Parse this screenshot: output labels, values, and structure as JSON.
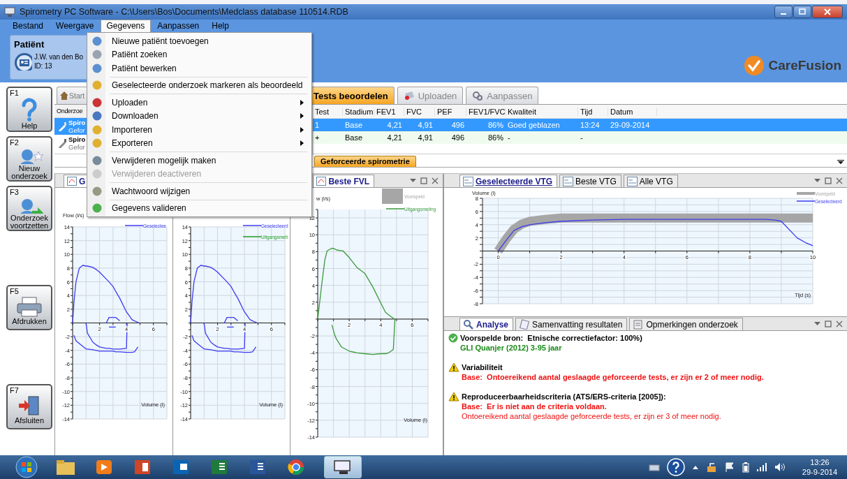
{
  "window": {
    "title": "Spirometry PC Software - C:\\Users\\Bos\\Documents\\Medclass database 110514.RDB"
  },
  "menu_bar": [
    {
      "label": "Bestand",
      "selected": false
    },
    {
      "label": "Weergave",
      "selected": false
    },
    {
      "label": "Gegevens",
      "selected": true
    },
    {
      "label": "Aanpassen",
      "selected": false
    },
    {
      "label": "Help",
      "selected": false
    }
  ],
  "dropdown_menu": {
    "groups": [
      [
        {
          "label": "Nieuwe patiënt toevoegen",
          "submenu": false,
          "disabled": false
        },
        {
          "label": "Patiënt zoeken",
          "submenu": false,
          "disabled": false
        },
        {
          "label": "Patiënt bewerken",
          "submenu": false,
          "disabled": false
        }
      ],
      [
        {
          "label": "Geselecteerde onderzoek markeren als beoordeeld",
          "submenu": false,
          "disabled": false
        }
      ],
      [
        {
          "label": "Uploaden",
          "submenu": true,
          "disabled": false
        },
        {
          "label": "Downloaden",
          "submenu": true,
          "disabled": false
        },
        {
          "label": "Importeren",
          "submenu": true,
          "disabled": false
        },
        {
          "label": "Exporteren",
          "submenu": true,
          "disabled": false
        }
      ],
      [
        {
          "label": "Verwijderen mogelijk maken",
          "submenu": false,
          "disabled": false
        },
        {
          "label": "Verwijderen deactiveren",
          "submenu": false,
          "disabled": true
        }
      ],
      [
        {
          "label": "Wachtwoord wijzigen",
          "submenu": false,
          "disabled": false
        }
      ],
      [
        {
          "label": "Gegevens valideren",
          "submenu": false,
          "disabled": false
        }
      ]
    ]
  },
  "patient": {
    "title": "Patiënt",
    "name": "J.W. van den Bo",
    "id": "ID: 13"
  },
  "logo": {
    "text": "CareFusion"
  },
  "function_keys": [
    {
      "key": "F1",
      "label": "Help"
    },
    {
      "key": "F2",
      "label": "Nieuw onderzoek"
    },
    {
      "key": "F3",
      "label": "Onderzoek voortzetten"
    },
    {
      "key": "F5",
      "label": "Afdrukken"
    },
    {
      "key": "F7",
      "label": "Afsluiten"
    }
  ],
  "main_tabs": [
    {
      "label": "Start",
      "selected": false
    },
    {
      "label": "Tests beoordelen",
      "selected": true
    },
    {
      "label": "Uploaden",
      "selected": false
    },
    {
      "label": "Aanpassen",
      "selected": false
    }
  ],
  "exam_list": {
    "header": "Onderzoe",
    "items": [
      {
        "title": "Spiro",
        "subtitle": "Gefor",
        "selected": true
      },
      {
        "title": "Spiro",
        "subtitle": "Gefor",
        "selected": false
      }
    ]
  },
  "tests_table": {
    "columns": [
      "Test",
      "Stadium",
      "FEV1",
      "FVC",
      "PEF",
      "FEV1/FVC",
      "Kwaliteit",
      "Tijd",
      "Datum"
    ],
    "rows": [
      {
        "cells": [
          "1",
          "Base",
          "4,21",
          "4,91",
          "496",
          "86%",
          "Goed geblazen",
          "13:24",
          "29-09-2014"
        ],
        "selected": true
      },
      {
        "cells": [
          "+",
          "Base",
          "4,21",
          "4,91",
          "496",
          "86%",
          "-",
          "-"
        ],
        "selected": false
      }
    ]
  },
  "test_type_tabs": [
    {
      "label": "Geforceerde spirometrie",
      "selected": true
    }
  ],
  "fvl_panes": [
    {
      "tab": {
        "label": "G",
        "selected": true
      },
      "chart_data": {
        "type": "line",
        "xlabel": "Volume (l)",
        "ylabel": "Flow (l/s)",
        "xlim": [
          0,
          7
        ],
        "ylim": [
          -14,
          14
        ],
        "xticks": [
          2,
          4,
          6
        ],
        "yticks": [
          -14,
          -12,
          -10,
          -8,
          -6,
          -4,
          -2,
          2,
          4,
          6,
          8,
          10,
          12,
          14
        ],
        "grid": true,
        "legend": true,
        "x": [
          0,
          0.1,
          0.25,
          0.5,
          0.75,
          1,
          1.1,
          1.5,
          1.75,
          2,
          2.5,
          2.7,
          3,
          3.2,
          3.5,
          4,
          4.05,
          4.4,
          4.6,
          4.85,
          4.9
        ],
        "series": [
          {
            "name": "Geselectee",
            "color": "#3c3cf0",
            "values": [
              0,
              3,
              6,
              8,
              8.4,
              8.3,
              8.3,
              8.1,
              7.8,
              7.4,
              6.4,
              6,
              5.3,
              4.6,
              3.6,
              1.6,
              1.5,
              0.5,
              0.3,
              0.1,
              0
            ]
          },
          {
            "color": "#3c3cf0",
            "values": [
              null,
              -1.8,
              -2.6,
              -3,
              -3.4,
              -3.8,
              -3.8,
              -3.9,
              -4,
              -4.1,
              -4.1,
              -4.1,
              -4.1,
              -4.2,
              -4.2,
              -4.3,
              -4.3,
              -4.3,
              -4.2,
              -3.5,
              null
            ]
          },
          {
            "color": "#3c3cf0",
            "values": [
              null,
              null,
              null,
              null,
              null,
              0,
              -1.5,
              -2.8,
              -3.2,
              -3.5,
              -3.7,
              -3.7,
              -3.8,
              -3.8,
              -3.8,
              -3.7,
              0,
              null,
              null,
              null,
              null
            ]
          },
          {
            "color": "#3c3cf0",
            "values": [
              null,
              null,
              null,
              null,
              null,
              null,
              null,
              null,
              null,
              null,
              0,
              0.8,
              0.8,
              0.8,
              0.3,
              null,
              null,
              null,
              null,
              null,
              null
            ]
          },
          {
            "color": "#3c3cf0",
            "values": [
              null,
              null,
              null,
              null,
              null,
              null,
              null,
              null,
              null,
              null,
              null,
              -0.6,
              -0.6,
              -0.6,
              null,
              null,
              null,
              null,
              null,
              null,
              null
            ]
          }
        ]
      }
    },
    {
      "chart_data": {
        "type": "line",
        "xlabel": "Volume (l)",
        "xlim": [
          0,
          7
        ],
        "ylim": [
          -14,
          14
        ],
        "xticks": [
          2,
          4,
          6
        ],
        "yticks": [
          -14,
          -12,
          -10,
          -8,
          -6,
          -4,
          -2,
          2,
          4,
          6,
          8,
          10,
          12,
          14
        ],
        "grid": true,
        "legend": true,
        "x": [
          0,
          0.1,
          0.25,
          0.5,
          0.75,
          1,
          1.1,
          1.5,
          1.75,
          2,
          2.5,
          2.7,
          3,
          3.2,
          3.5,
          4,
          4.05,
          4.4,
          4.6,
          4.85,
          4.9
        ],
        "series": [
          {
            "name": "Geselecteerd",
            "color": "#3c3cf0",
            "values": [
              0,
              3,
              6,
              8,
              8.4,
              8.3,
              8.3,
              8.1,
              7.8,
              7.4,
              6.4,
              6,
              5.3,
              4.6,
              3.6,
              1.6,
              1.5,
              0.5,
              0.3,
              0.1,
              0
            ]
          },
          {
            "color": "#3c3cf0",
            "values": [
              null,
              -1.8,
              -2.6,
              -3,
              -3.4,
              -3.8,
              -3.8,
              -3.9,
              -4,
              -4.1,
              -4.1,
              -4.1,
              -4.1,
              -4.2,
              -4.2,
              -4.3,
              -4.3,
              -4.3,
              -4.2,
              -3.5,
              null
            ]
          },
          {
            "color": "#3c3cf0",
            "values": [
              null,
              null,
              null,
              null,
              null,
              0,
              -1.5,
              -2.8,
              -3.2,
              -3.5,
              -3.7,
              -3.7,
              -3.8,
              -3.8,
              -3.8,
              -3.7,
              0,
              null,
              null,
              null,
              null
            ]
          },
          {
            "color": "#3c3cf0",
            "values": [
              null,
              null,
              null,
              null,
              null,
              null,
              null,
              null,
              null,
              null,
              0,
              0.8,
              0.8,
              0.8,
              0.3,
              null,
              null,
              null,
              null,
              null,
              null
            ]
          },
          {
            "color": "#3c3cf0",
            "values": [
              null,
              null,
              null,
              null,
              null,
              null,
              null,
              null,
              null,
              null,
              null,
              -0.6,
              -0.6,
              -0.6,
              null,
              null,
              null,
              null,
              null,
              null,
              null
            ]
          },
          {
            "name": "Uitgangsmeti",
            "color": "#1e9a1e",
            "values": [
              null,
              null,
              null,
              null,
              null,
              null,
              null,
              null,
              null,
              null,
              null,
              null,
              null,
              null,
              null,
              null,
              null,
              null,
              null,
              null,
              null
            ]
          }
        ]
      }
    },
    {
      "tab": {
        "label": "Beste FVL",
        "selected": true
      },
      "controls": true,
      "chart_data": {
        "type": "line",
        "xlabel": "Volume (l)",
        "ylabel": "w (l/s)",
        "xlim": [
          0,
          7
        ],
        "ylim": [
          -14,
          13
        ],
        "xticks": [
          2,
          4,
          6
        ],
        "yticks": [
          -14,
          -12,
          -10,
          -8,
          -6,
          -4,
          -2,
          2,
          4,
          6,
          8,
          10,
          12
        ],
        "grid": true,
        "legend": true,
        "x": [
          0,
          0.25,
          0.45,
          0.6,
          0.9,
          1.1,
          1.2,
          1.5,
          1.6,
          2,
          2.5,
          3,
          3.5,
          4,
          4.3,
          4.5,
          4.8,
          4.9
        ],
        "series": [
          {
            "name": "Voorspeld",
            "color": "#a6a6a6",
            "values": [
              null,
              null,
              null,
              null,
              null,
              null,
              null,
              null,
              null,
              null,
              null,
              null,
              null,
              null,
              null,
              null,
              null,
              null
            ]
          },
          {
            "name": "Uitgangsmeting",
            "color": "#3a9a3a",
            "values": [
              0,
              4,
              7,
              8.1,
              8.4,
              8.3,
              8.2,
              8.1,
              8.1,
              7.3,
              6.1,
              5.4,
              3.8,
              1.9,
              0.8,
              0.5,
              0.1,
              0
            ]
          },
          {
            "color": "#3a9a3a",
            "values": [
              null,
              null,
              null,
              null,
              -0.7,
              -2,
              -2.4,
              -3.3,
              -3.4,
              -3.8,
              -4,
              -4.1,
              -4.2,
              -4.1,
              -4.1,
              -4,
              -3.6,
              0
            ]
          }
        ]
      }
    }
  ],
  "vtg_panel": {
    "tabs": [
      {
        "label": "Geselecteerde VTG",
        "selected": true
      },
      {
        "label": "Beste VTG",
        "selected": false
      },
      {
        "label": "Alle VTG",
        "selected": false
      }
    ],
    "chart_data": {
      "type": "line",
      "xlabel": "Tijd (s)",
      "ylabel": "Volume (l)",
      "xlim": [
        -0.5,
        10
      ],
      "ylim": [
        -8,
        8
      ],
      "xticks": [
        0,
        2,
        4,
        6,
        8,
        10
      ],
      "yticks": [
        -8,
        -6,
        -4,
        -2,
        2,
        4,
        6,
        8
      ],
      "grid": true,
      "legend": true,
      "x": [
        0,
        0.25,
        0.5,
        0.75,
        1,
        1.5,
        2,
        3,
        4,
        5,
        6,
        7,
        8,
        8.5,
        8.8,
        9,
        9.5,
        9.8,
        10
      ],
      "series": [
        {
          "name": "Voorspeld",
          "color": "#a6a6a6",
          "values": [
            0,
            1.8,
            3.3,
            4.1,
            4.5,
            4.8,
            5,
            5,
            5,
            5,
            5,
            5,
            5,
            5,
            5,
            5,
            5,
            5,
            5
          ]
        },
        {
          "name": "Geselecteerd",
          "color": "#3c3cf0",
          "values": [
            0,
            1.6,
            3.1,
            3.7,
            4,
            4.3,
            4.5,
            4.7,
            4.8,
            4.8,
            4.8,
            4.8,
            4.8,
            4.8,
            4.7,
            4.5,
            2,
            1.2,
            0.8
          ]
        }
      ]
    }
  },
  "analysis_panel": {
    "tabs": [
      {
        "label": "Analyse",
        "selected": true
      },
      {
        "label": "Samenvatting resultaten",
        "selected": false
      },
      {
        "label": "Opmerkingen onderzoek",
        "selected": false
      }
    ],
    "items": [
      {
        "kind": "ok",
        "title": "Voorspelde bron:  Etnische correctiefactor: 100%)",
        "lines": [
          {
            "text": "GLI Quanjer (2012) 3-95 jaar",
            "bold": true
          }
        ]
      },
      {
        "kind": "warning",
        "title": "Variabiliteit",
        "lines": [
          {
            "text": "Base:  Ontoereikend aantal geslaagde geforceerde tests, er zijn er 2 of meer nodig.",
            "bold": true
          }
        ]
      },
      {
        "kind": "warning",
        "title": "Reproduceerbaarheidscriteria (ATS/ERS-criteria [2005]):",
        "lines": [
          {
            "text": "Base:  Er is niet aan de criteria voldaan.",
            "bold": true
          },
          {
            "text": "Ontoereikend aantal geslaagde geforceerde tests, er zijn er 3 of meer nodig.",
            "bold": false
          }
        ]
      }
    ]
  },
  "taskbar": {
    "time": "13:26",
    "date": "29-9-2014"
  }
}
